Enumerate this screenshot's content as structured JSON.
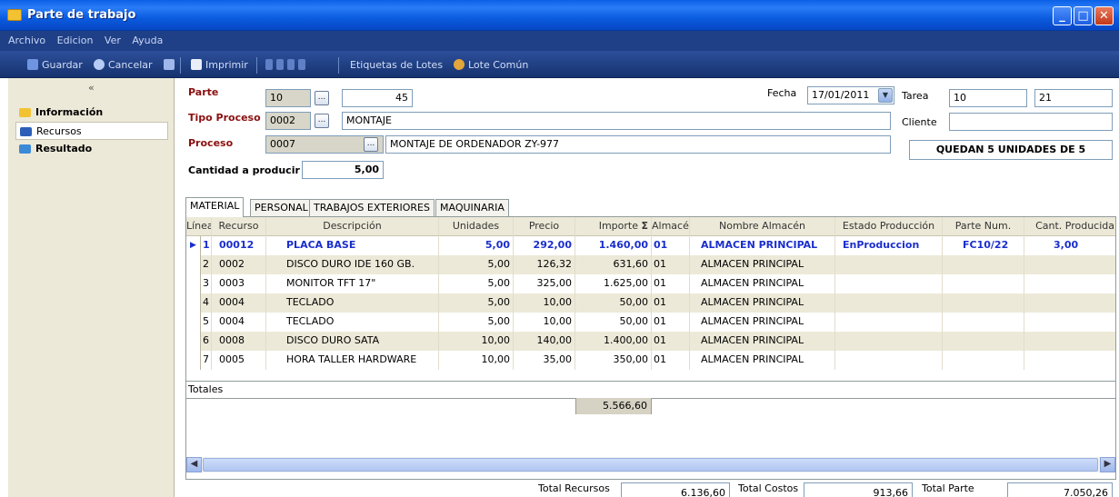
{
  "window": {
    "title": "Parte de trabajo"
  },
  "menu": [
    "Archivo",
    "Edicion",
    "Ver",
    "Ayuda"
  ],
  "toolbar": {
    "save": "Guardar",
    "cancel": "Cancelar",
    "print": "Imprimir",
    "lot_labels": "Etiquetas de Lotes",
    "common_lot": "Lote Común"
  },
  "nav": {
    "collapse": "«",
    "items": [
      "Información",
      "Recursos",
      "Resultado"
    ]
  },
  "form": {
    "parte_label": "Parte",
    "parte_serie": "10",
    "parte_num": "45",
    "tipo_label": "Tipo Proceso",
    "tipo_code": "0002",
    "tipo_desc": "MONTAJE",
    "proceso_label": "Proceso",
    "proceso_code": "0007",
    "proceso_desc": "MONTAJE DE ORDENADOR ZY-977",
    "cantidad_label": "Cantidad a producir",
    "cantidad": "5,00",
    "fecha_label": "Fecha",
    "fecha": "17/01/2011",
    "tarea_label": "Tarea",
    "tarea_1": "10",
    "tarea_2": "21",
    "cliente_label": "Cliente",
    "cliente": "",
    "quedan": "QUEDAN 5 UNIDADES DE 5"
  },
  "tabs": [
    "MATERIAL",
    "PERSONAL",
    "TRABAJOS EXTERIORES",
    "MAQUINARIA"
  ],
  "grid": {
    "headers": [
      "Línea",
      "Recurso",
      "Descripción",
      "Unidades",
      "Precio",
      "Importe",
      "Almacé",
      "Nombre Almacén",
      "Estado Producción",
      "Parte Num.",
      "Cant. Producida"
    ],
    "rows": [
      [
        "1",
        "00012",
        "PLACA BASE",
        "5,00",
        "292,00",
        "1.460,00",
        "01",
        "ALMACEN PRINCIPAL",
        "EnProduccion",
        "FC10/22",
        "3,00"
      ],
      [
        "2",
        "0002",
        "DISCO DURO IDE 160 GB.",
        "5,00",
        "126,32",
        "631,60",
        "01",
        "ALMACEN PRINCIPAL",
        "",
        "",
        ""
      ],
      [
        "3",
        "0003",
        "MONITOR TFT 17\"",
        "5,00",
        "325,00",
        "1.625,00",
        "01",
        "ALMACEN PRINCIPAL",
        "",
        "",
        ""
      ],
      [
        "4",
        "0004",
        "TECLADO",
        "5,00",
        "10,00",
        "50,00",
        "01",
        "ALMACEN PRINCIPAL",
        "",
        "",
        ""
      ],
      [
        "5",
        "0004",
        "TECLADO",
        "5,00",
        "10,00",
        "50,00",
        "01",
        "ALMACEN PRINCIPAL",
        "",
        "",
        ""
      ],
      [
        "6",
        "0008",
        "DISCO DURO SATA",
        "10,00",
        "140,00",
        "1.400,00",
        "01",
        "ALMACEN PRINCIPAL",
        "",
        "",
        ""
      ],
      [
        "7",
        "0005",
        "HORA TALLER HARDWARE",
        "10,00",
        "35,00",
        "350,00",
        "01",
        "ALMACEN PRINCIPAL",
        "",
        "",
        ""
      ]
    ],
    "totals_label": "Totales",
    "total_importe": "5.566,60"
  },
  "footer": {
    "recursos_label": "Total Recursos",
    "recursos": "6.136,60",
    "costos_label": "Total Costos",
    "costos": "913,66",
    "parte_label": "Total Parte",
    "parte": "7.050,26"
  }
}
